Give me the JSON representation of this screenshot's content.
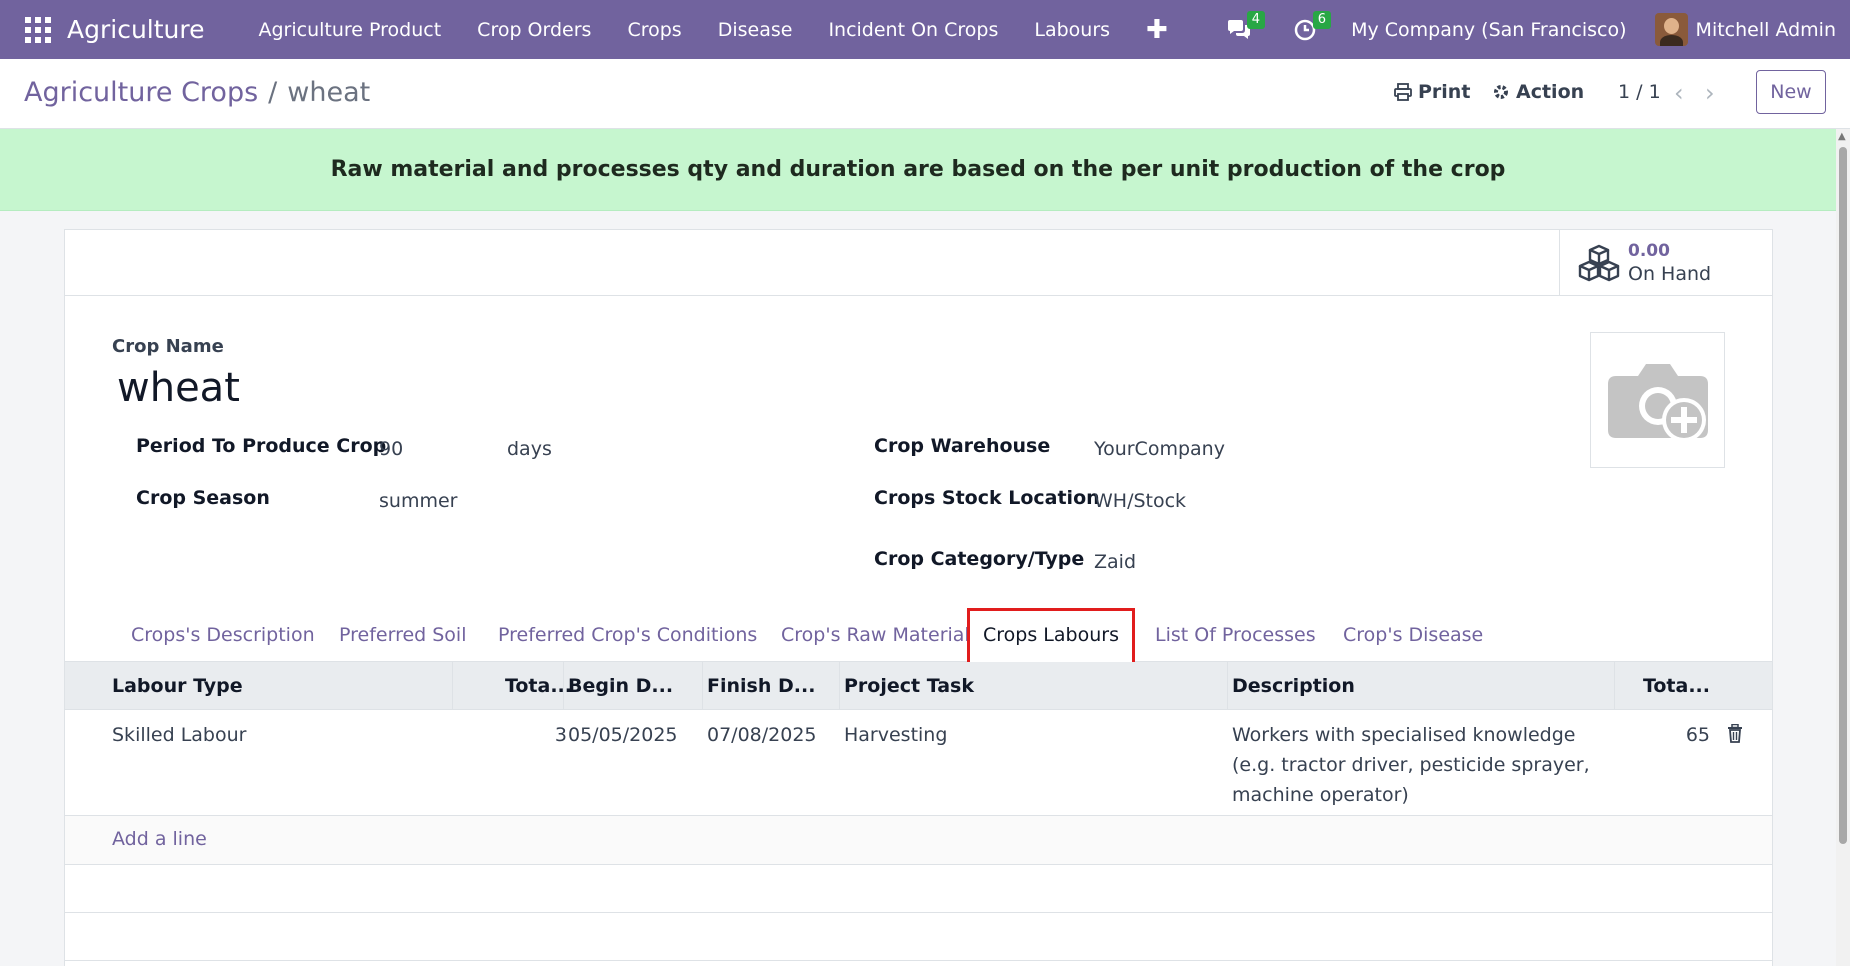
{
  "navbar": {
    "app_name": "Agriculture",
    "menu": [
      "Agriculture Product",
      "Crop Orders",
      "Crops",
      "Disease",
      "Incident On Crops",
      "Labours"
    ],
    "messages_count": "4",
    "activities_count": "6",
    "company": "My Company (San Francisco)",
    "user": "Mitchell Admin"
  },
  "control": {
    "breadcrumb_parent": "Agriculture Crops",
    "breadcrumb_sep": "/",
    "breadcrumb_current": "wheat",
    "print_label": "Print",
    "action_label": "Action",
    "pager": "1 / 1",
    "new_label": "New"
  },
  "alert": "Raw material and processes qty and duration are based on the per unit production of the crop",
  "stat": {
    "value": "0.00",
    "label": "On Hand"
  },
  "form": {
    "name_label": "Crop Name",
    "name_value": "wheat",
    "period_label": "Period To Produce Crop",
    "period_value": "90",
    "period_unit": "days",
    "season_label": "Crop Season",
    "season_value": "summer",
    "warehouse_label": "Crop Warehouse",
    "warehouse_value": "YourCompany",
    "location_label": "Crops Stock Location",
    "location_value": "WH/Stock",
    "category_label": "Crop Category/Type",
    "category_value": "Zaid"
  },
  "tabs": [
    "Crops's Description",
    "Preferred Soil",
    "Preferred Crop's Conditions",
    "Crop's Raw Material",
    "Crops Labours",
    "List Of Processes",
    "Crop's Disease"
  ],
  "active_tab": "Crops Labours",
  "list": {
    "columns": [
      "Labour Type",
      "Tota...",
      "Begin D...",
      "Finish D...",
      "Project Task",
      "Description",
      "Tota..."
    ],
    "rows": [
      {
        "labour_type": "Skilled Labour",
        "total_qty": "3",
        "begin_date": "05/05/2025",
        "finish_date": "07/08/2025",
        "project_task": "Harvesting",
        "description": "Workers with specialised knowledge (e.g. tractor driver, pesticide sprayer, machine operator)",
        "total": "65"
      }
    ],
    "add_line": "Add a line"
  }
}
